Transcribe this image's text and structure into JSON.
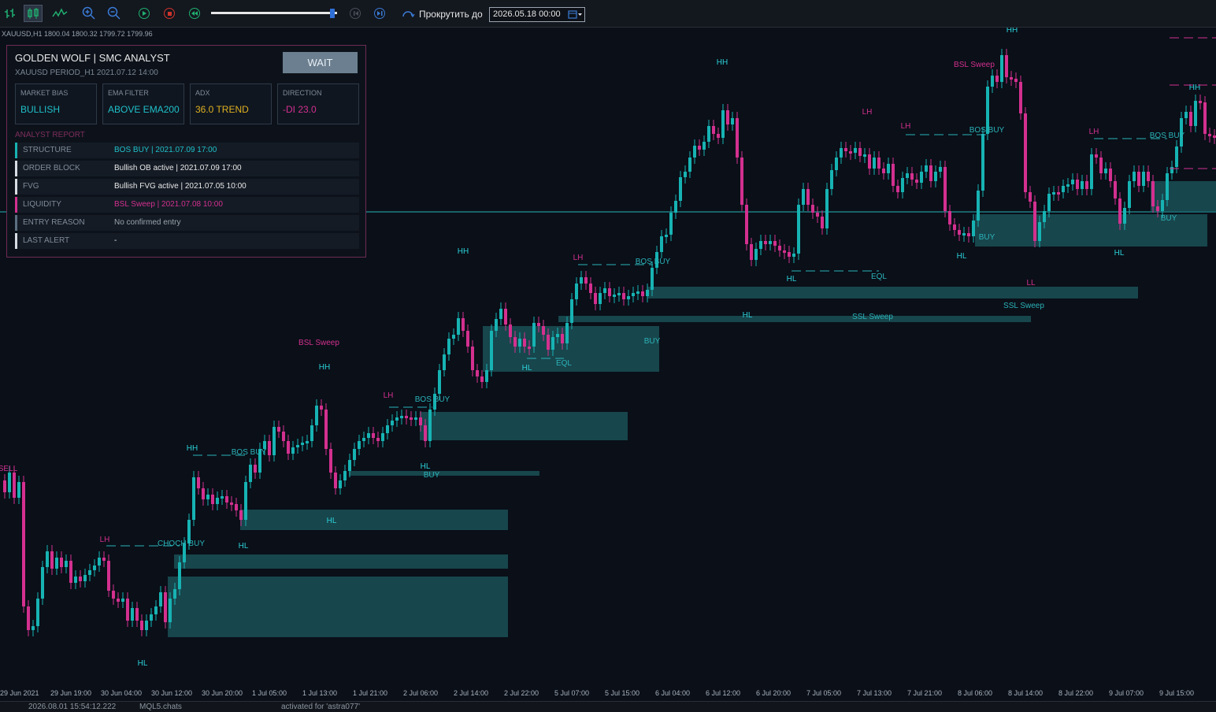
{
  "toolbar": {
    "buttons": [
      "bar-chart",
      "candle-chart",
      "line-chart",
      "zoom-in",
      "zoom-out",
      "play",
      "stop",
      "rewind",
      "step-back",
      "step-forward"
    ],
    "speed_level": 0.96,
    "scroll_label": "Прокрутить до",
    "scroll_date": "2026.05.18 00:00"
  },
  "chart": {
    "symbol_info": "XAUUSD,H1  1800.04 1800.32 1799.72 1799.96",
    "time_labels": [
      "29 Jun 2021",
      "29 Jun 19:00",
      "30 Jun 04:00",
      "30 Jun 12:00",
      "30 Jun 20:00",
      "1 Jul 05:00",
      "1 Jul 13:00",
      "1 Jul 21:00",
      "2 Jul 06:00",
      "2 Jul 14:00",
      "2 Jul 22:00",
      "5 Jul 07:00",
      "5 Jul 15:00",
      "6 Jul 04:00",
      "6 Jul 12:00",
      "6 Jul 20:00",
      "7 Jul 05:00",
      "7 Jul 13:00",
      "7 Jul 21:00",
      "8 Jul 06:00",
      "8 Jul 14:00",
      "8 Jul 22:00",
      "9 Jul 07:00",
      "9 Jul 15:00"
    ],
    "annotations": [
      "HH",
      "HL",
      "LH",
      "LL",
      "EQL",
      "BOS BUY",
      "CHOCH BUY",
      "BSL Sweep",
      "SSL Sweep",
      "BUY",
      "SELL"
    ],
    "colors": {
      "bull": "#17b3b3",
      "bear": "#d3308f",
      "zone": "#1c5a5e",
      "background": "#0a0f18"
    }
  },
  "panel": {
    "title": "GOLDEN WOLF  |  SMC ANALYST",
    "subtitle": "XAUUSD  PERIOD_H1  2021.07.12 14:00",
    "action": "WAIT",
    "cards": [
      {
        "label": "MARKET BIAS",
        "value": "BULLISH",
        "color": "#1fc0c8"
      },
      {
        "label": "EMA FILTER",
        "value": "ABOVE EMA200",
        "color": "#1fc0c8"
      },
      {
        "label": "ADX",
        "value": "36.0 TREND",
        "color": "#e0b020"
      },
      {
        "label": "DIRECTION",
        "value": "-DI 23.0",
        "color": "#d3308f"
      }
    ],
    "report_title": "ANALYST REPORT",
    "rows": [
      {
        "key": "STRUCTURE",
        "value": "BOS BUY | 2021.07.09 17:00",
        "bar": "#17b3b3",
        "color": "#1fc0c8"
      },
      {
        "key": "ORDER BLOCK",
        "value": "Bullish OB active | 2021.07.09 17:00",
        "bar": "#d8dde3",
        "color": "#e8e8e8"
      },
      {
        "key": "FVG",
        "value": "Bullish FVG active | 2021.07.05 10:00",
        "bar": "#d8dde3",
        "color": "#e8e8e8"
      },
      {
        "key": "LIQUIDITY",
        "value": "BSL Sweep | 2021.07.08 10:00",
        "bar": "#d3308f",
        "color": "#d3308f"
      },
      {
        "key": "ENTRY REASON",
        "value": "No confirmed entry",
        "bar": "#5b6f80",
        "color": "#9aa3ad"
      },
      {
        "key": "LAST ALERT",
        "value": "-",
        "bar": "#d8dde3",
        "color": "#e8e8e8"
      }
    ]
  },
  "status": {
    "timestamp": "2026.08.01 15:54:12.222",
    "source": "MQL5.chats",
    "message": "activated for 'astra077'"
  }
}
